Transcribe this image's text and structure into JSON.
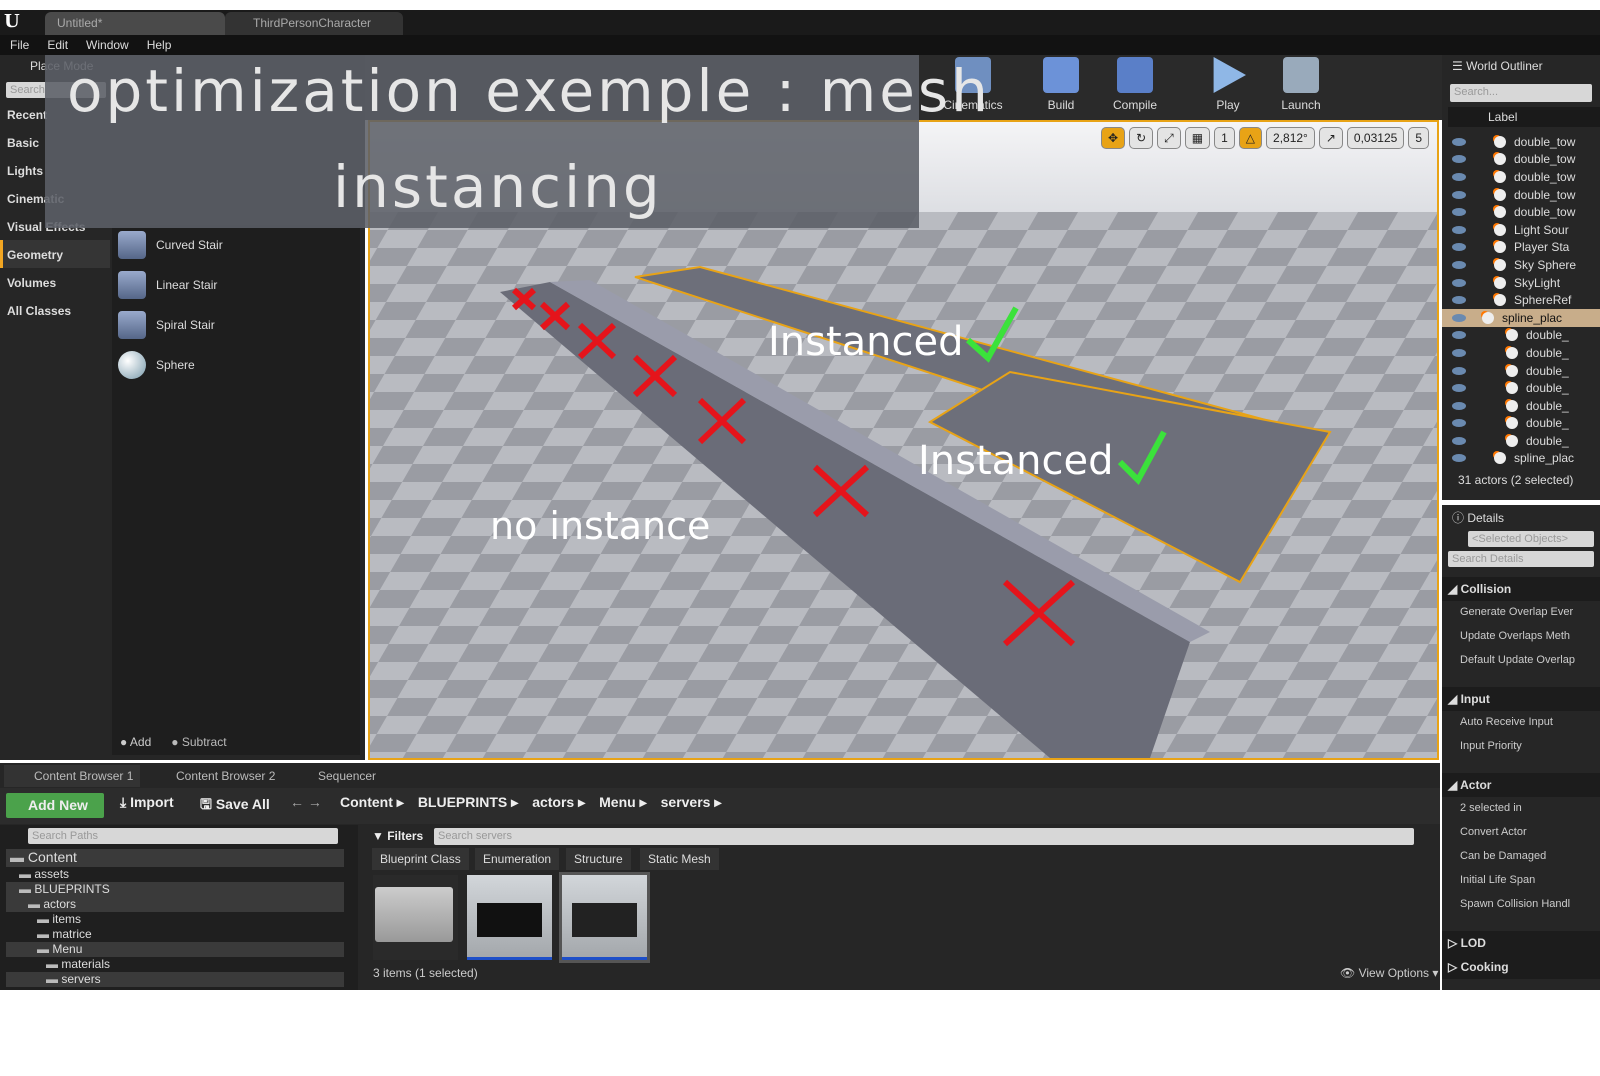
{
  "tabs": [
    {
      "label": "Untitled*"
    },
    {
      "label": "ThirdPersonCharacter"
    }
  ],
  "menu": [
    "File",
    "Edit",
    "Window",
    "Help"
  ],
  "place": {
    "title": "Place Mode",
    "search_placeholder": "Search",
    "categories": [
      "Recent",
      "Basic",
      "Lights",
      "Cinematic",
      "Visual Effects",
      "Geometry",
      "Volumes",
      "All Classes"
    ],
    "selected": "Geometry",
    "items": [
      "Curved Stair",
      "Linear Stair",
      "Spiral Stair",
      "Sphere"
    ],
    "add": "Add",
    "subtract": "Subtract"
  },
  "toolbar": [
    "Cinematics",
    "Build",
    "Compile",
    "Play",
    "Launch"
  ],
  "viewport": {
    "grid": "1",
    "angle": "2,812°",
    "scale": "0,03125",
    "speed": "5",
    "labels": {
      "instanced1": "Instanced",
      "instanced2": "Instanced",
      "no_instance": "no instance"
    }
  },
  "overlay": {
    "line1": "optimization exemple : mesh",
    "line2": "instancing"
  },
  "outliner": {
    "title": "World Outliner",
    "search_placeholder": "Search...",
    "column": "Label",
    "rows": [
      "double_tow",
      "double_tow",
      "double_tow",
      "double_tow",
      "double_tow",
      "Light Sour",
      "Player Sta",
      "Sky Sphere",
      "SkyLight",
      "SphereRef",
      "spline_plac",
      "double_",
      "double_",
      "double_",
      "double_",
      "double_",
      "double_",
      "double_",
      "spline_plac"
    ],
    "selected_index": 10,
    "status": "31 actors (2 selected)"
  },
  "details": {
    "title": "Details",
    "selected": "<Selected Objects>",
    "search_placeholder": "Search Details",
    "sections": [
      {
        "name": "Collision",
        "rows": [
          "Generate Overlap Ever",
          "Update Overlaps Meth",
          "Default Update Overlap"
        ]
      },
      {
        "name": "Input",
        "rows": [
          "Auto Receive Input",
          "Input Priority"
        ]
      },
      {
        "name": "Actor",
        "rows": [
          "2 selected in",
          "Convert Actor",
          "Can be Damaged",
          "Initial Life Span",
          "Spawn Collision Handl"
        ]
      }
    ],
    "collapsed": [
      "LOD",
      "Cooking"
    ]
  },
  "content_browser": {
    "tabs": [
      "Content Browser 1",
      "Content Browser 2",
      "Sequencer"
    ],
    "add_new": "Add New",
    "import": "Import",
    "save_all": "Save All",
    "breadcrumb": [
      "Content",
      "BLUEPRINTS",
      "actors",
      "Menu",
      "servers"
    ],
    "search_paths_placeholder": "Search Paths",
    "tree": [
      "Content",
      "assets",
      "BLUEPRINTS",
      "actors",
      "items",
      "matrice",
      "Menu",
      "materials",
      "servers"
    ],
    "filters": "Filters",
    "search_placeholder": "Search servers",
    "chips": [
      "Blueprint Class",
      "Enumeration",
      "Structure",
      "Static Mesh"
    ],
    "status": "3 items (1 selected)",
    "view_options": "View Options"
  }
}
